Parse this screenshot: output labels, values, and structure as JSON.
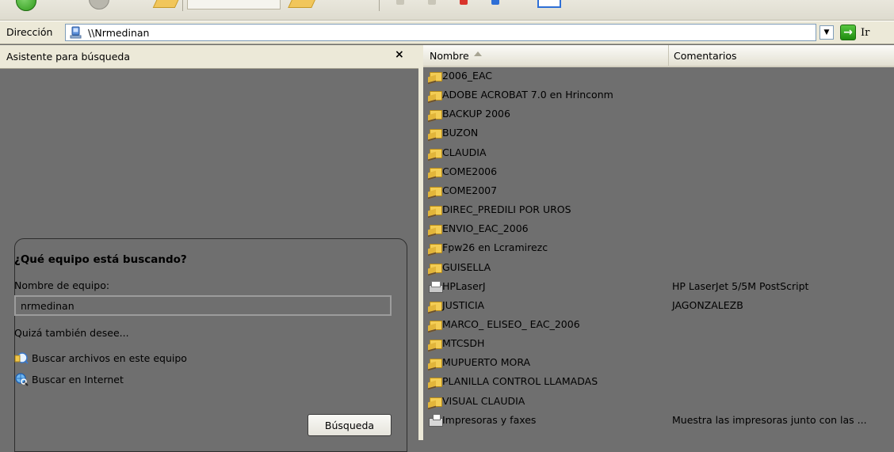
{
  "address_bar": {
    "label": "Dirección",
    "path": "\\\\Nrmedinan",
    "go_label": "Ir"
  },
  "search_pane": {
    "title": "Asistente para búsqueda",
    "close_glyph": "×",
    "question": "¿Qué equipo está buscando?",
    "computer_name_label": "Nombre de equipo:",
    "computer_name_value": "nrmedinan",
    "also_label": "Quizá también desee...",
    "links": [
      {
        "label": "Buscar archivos en este equipo",
        "icon": "search-files-icon"
      },
      {
        "label": "Buscar en Internet",
        "icon": "search-internet-icon"
      }
    ],
    "search_button": "Búsqueda"
  },
  "file_list": {
    "columns": [
      "Nombre",
      "Comentarios"
    ],
    "items": [
      {
        "name": "2006_EAC",
        "comment": "",
        "icon": "shared-folder-icon"
      },
      {
        "name": "ADOBE ACROBAT 7.0 en Hrinconm",
        "comment": "",
        "icon": "shared-folder-icon"
      },
      {
        "name": "BACKUP 2006",
        "comment": "",
        "icon": "shared-folder-icon"
      },
      {
        "name": "BUZON",
        "comment": "",
        "icon": "shared-folder-icon"
      },
      {
        "name": "CLAUDIA",
        "comment": "",
        "icon": "shared-folder-icon"
      },
      {
        "name": "COME2006",
        "comment": "",
        "icon": "shared-folder-icon"
      },
      {
        "name": "COME2007",
        "comment": "",
        "icon": "shared-folder-icon"
      },
      {
        "name": "DIREC_PREDILI POR UROS",
        "comment": "",
        "icon": "shared-folder-icon"
      },
      {
        "name": "ENVIO_EAC_2006",
        "comment": "",
        "icon": "shared-folder-icon"
      },
      {
        "name": "Fpw26 en Lcramirezc",
        "comment": "",
        "icon": "shared-folder-icon"
      },
      {
        "name": "GUISELLA",
        "comment": "",
        "icon": "shared-folder-icon"
      },
      {
        "name": "HPLaserJ",
        "comment": "HP LaserJet 5/5M PostScript",
        "icon": "printer-icon"
      },
      {
        "name": "JUSTICIA",
        "comment": "JAGONZALEZB",
        "icon": "shared-folder-icon"
      },
      {
        "name": "MARCO_ ELISEO_ EAC_2006",
        "comment": "",
        "icon": "shared-folder-icon"
      },
      {
        "name": "MTCSDH",
        "comment": "",
        "icon": "shared-folder-icon"
      },
      {
        "name": "MUPUERTO MORA",
        "comment": "",
        "icon": "shared-folder-icon"
      },
      {
        "name": "PLANILLA CONTROL LLAMADAS",
        "comment": "",
        "icon": "shared-folder-icon"
      },
      {
        "name": "VISUAL CLAUDIA",
        "comment": "",
        "icon": "shared-folder-icon"
      },
      {
        "name": "Impresoras y faxes",
        "comment": "Muestra las impresoras junto con las ...",
        "icon": "printers-faxes-icon"
      }
    ]
  },
  "colors": {
    "background": "#6f6f6f",
    "chrome": "#ece9d8",
    "go_green": "#2f9a1a",
    "folder_yellow": "#f3cd55"
  }
}
